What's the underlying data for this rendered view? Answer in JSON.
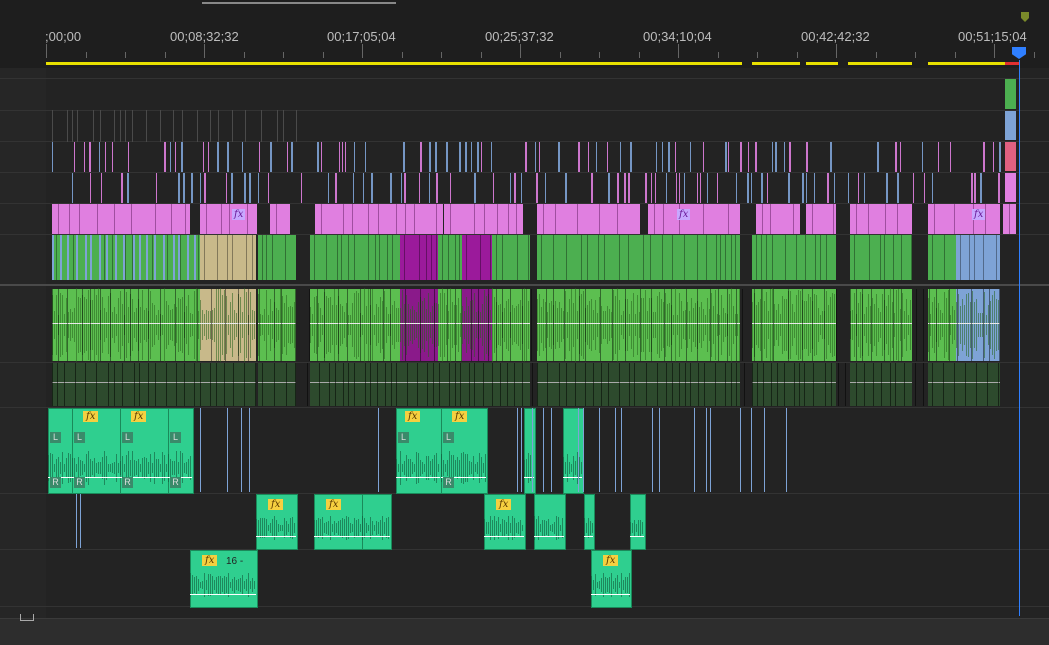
{
  "timeline": {
    "timecodes": [
      ";00;00",
      "00;08;32;32",
      "00;17;05;04",
      "00;25;37;32",
      "00;34;10;04",
      "00;42;42;32",
      "00;51;15;04"
    ],
    "fx_label": "fx",
    "channel_L": "L",
    "channel_R": "R",
    "clip_number_label": "16 -",
    "colors": {
      "video_pink": "#e07fe0",
      "video_green": "#4caf50",
      "video_blue": "#7ea3d6",
      "video_tan": "#c8b98a",
      "video_magenta": "#9b1a9b",
      "audio_teal": "#2fcf8f",
      "work_area": "#e8e000",
      "playhead": "#2f7fff"
    }
  }
}
